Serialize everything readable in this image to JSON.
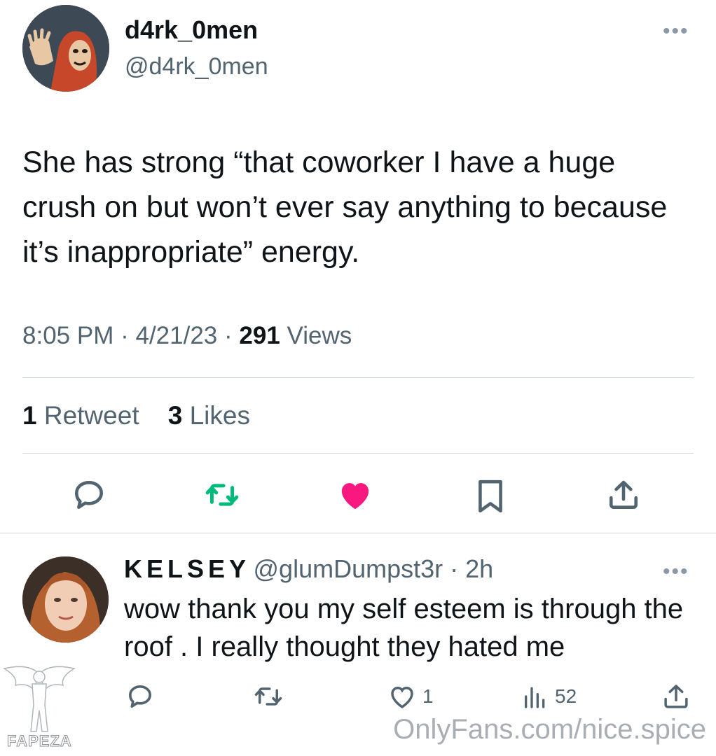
{
  "tweet": {
    "display_name": "d4rk_0men",
    "handle": "@d4rk_0men",
    "text": "She has strong “that coworker I have a huge crush on but won’t ever say anything to because it’s inappropriate” energy.",
    "time": "8:05 PM",
    "date": "4/21/23",
    "views_count": "291",
    "views_label": "Views",
    "retweets_count": "1",
    "retweets_label": "Retweet",
    "likes_count": "3",
    "likes_label": "Likes",
    "more_label": "•••",
    "colors": {
      "retweet": "#00ba7c",
      "like": "#f91880",
      "icon": "#536471"
    }
  },
  "reply": {
    "display_name": "KELSEY",
    "handle": "@glumDumpst3r",
    "time": "2h",
    "text": "wow thank you my self esteem is through the roof . I really thought they hated me",
    "likes_count": "1",
    "views_count": "52",
    "more_label": "•••"
  },
  "watermarks": {
    "right": "OnlyFans.com/nice.spice",
    "left": "FAPEZA"
  }
}
